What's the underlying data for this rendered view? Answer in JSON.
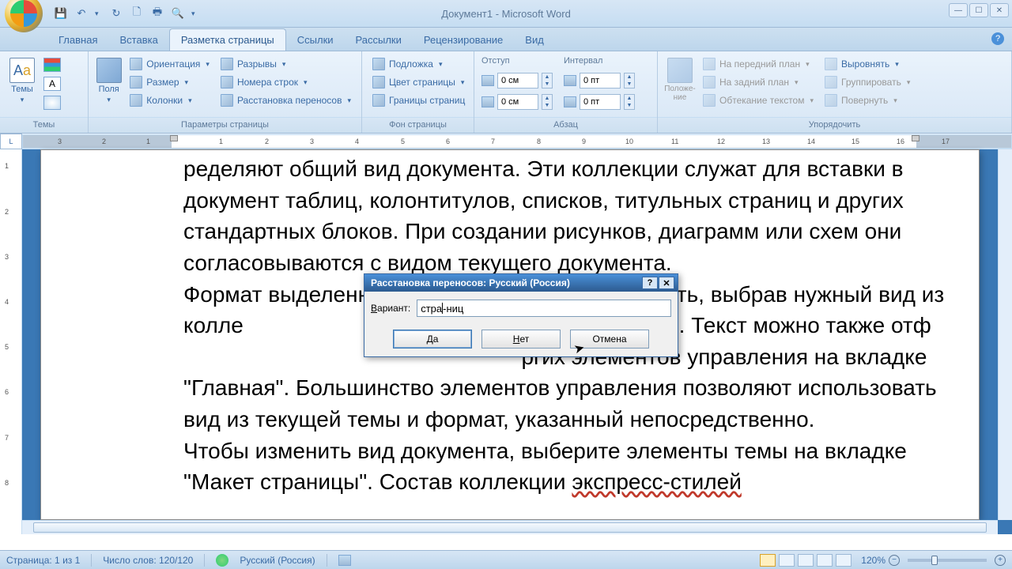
{
  "app_title": "Документ1 - Microsoft Word",
  "tabs": {
    "home": "Главная",
    "insert": "Вставка",
    "page_layout": "Разметка страницы",
    "references": "Ссылки",
    "mailings": "Рассылки",
    "review": "Рецензирование",
    "view": "Вид"
  },
  "ribbon": {
    "themes": {
      "label": "Темы",
      "btn": "Темы"
    },
    "page_setup": {
      "label": "Параметры страницы",
      "margins": "Поля",
      "orientation": "Ориентация",
      "size": "Размер",
      "columns": "Колонки",
      "breaks": "Разрывы",
      "line_numbers": "Номера строк",
      "hyphenation": "Расстановка переносов"
    },
    "page_bg": {
      "label": "Фон страницы",
      "watermark": "Подложка",
      "page_color": "Цвет страницы",
      "page_borders": "Границы страниц"
    },
    "paragraph": {
      "label": "Абзац",
      "indent_header": "Отступ",
      "spacing_header": "Интервал",
      "indent_left": "0 см",
      "indent_right": "0 см",
      "spacing_before": "0 пт",
      "spacing_after": "0 пт"
    },
    "arrange": {
      "label": "Упорядочить",
      "position": "Положе­ние",
      "bring_front": "На передний план",
      "send_back": "На задний план",
      "text_wrap": "Обтекание текстом",
      "align": "Выровнять",
      "group": "Группировать",
      "rotate": "Повернуть"
    }
  },
  "document": {
    "p1": "ределяют общий вид документа. Эти коллекции служат для вставки в документ таблиц, колонтитулов, списков, титульных страниц и других стандартных блоков. При создании рисунков, диаграмм или схем они согласовываются с видом текущего документа.",
    "p2a": "Формат выделенн",
    "p2b": "нить, выбрав нуж­ный вид из колле",
    "p2c": "дке \"Главная\". Текст можно также отф",
    "p2d": "ргих элементов управления на вкладке \"Главная\". Большинство элементов управ­ления позволяют использовать вид из текущей темы и формат, ука­занный непосредственно.",
    "p3a": "Чтобы изменить вид документа, выберите элементы темы на вкладке \"Макет страницы\". Состав коллекции ",
    "p3b": "экспресс-стилей"
  },
  "dialog": {
    "title": "Расстановка переносов: Русский (Россия)",
    "variant_label": "Вариант:",
    "input_before": "стра",
    "input_after": "ниц",
    "yes": "Да",
    "no": "Нет",
    "cancel": "Отмена"
  },
  "status": {
    "page": "Страница: 1 из 1",
    "words": "Число слов: 120/120",
    "language": "Русский (Россия)",
    "zoom": "120%"
  }
}
